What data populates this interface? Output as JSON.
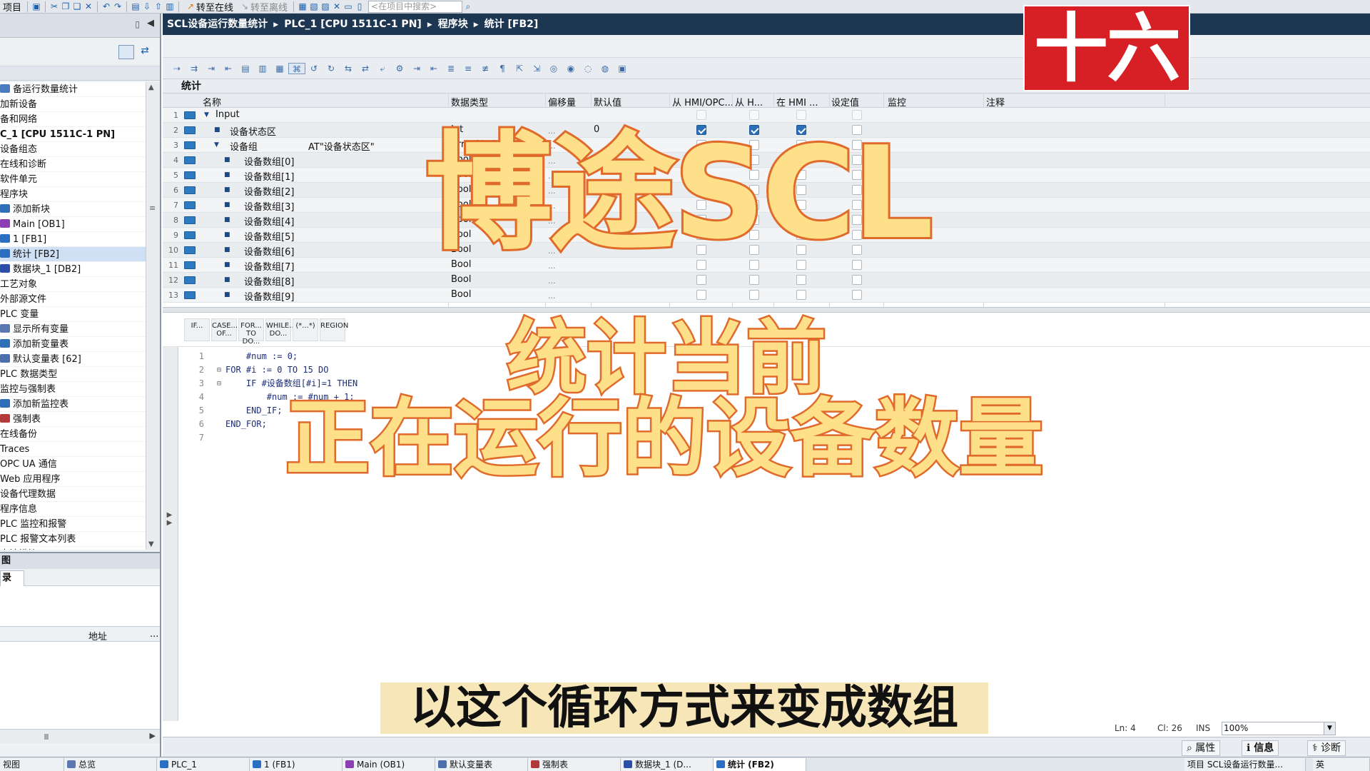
{
  "colors": {
    "accent": "#1d3652",
    "overlay_fill": "#ffe08a",
    "overlay_stroke": "#e06a2a",
    "badge": "#d71f26"
  },
  "toolbar": {
    "project_menu": "项目",
    "go_online": "转至在线",
    "go_offline": "转至离线",
    "search_placeholder": "<在项目中搜索>"
  },
  "breadcrumb": [
    "SCL设备运行数量统计",
    "PLC_1 [CPU 1511C-1 PN]",
    "程序块",
    "统计 [FB2]"
  ],
  "block_name": "统计",
  "tree": [
    {
      "label": "备运行数量统计",
      "icon": "project-icon",
      "sel": false
    },
    {
      "label": "加新设备",
      "icon": "",
      "sel": false
    },
    {
      "label": "备和网络",
      "icon": "",
      "sel": false
    },
    {
      "label": "C_1 [CPU 1511C-1 PN]",
      "icon": "",
      "sel": false,
      "bold": true
    },
    {
      "label": "设备组态",
      "icon": "",
      "sel": false
    },
    {
      "label": "在线和诊断",
      "icon": "",
      "sel": false
    },
    {
      "label": "软件单元",
      "icon": "",
      "sel": false
    },
    {
      "label": "程序块",
      "icon": "",
      "sel": false
    },
    {
      "label": "添加新块",
      "icon": "add-block-icon",
      "sel": false
    },
    {
      "label": "Main [OB1]",
      "icon": "ob-icon",
      "sel": false
    },
    {
      "label": "1 [FB1]",
      "icon": "fb-icon",
      "sel": false
    },
    {
      "label": "统计 [FB2]",
      "icon": "fb-icon",
      "sel": true
    },
    {
      "label": "数据块_1 [DB2]",
      "icon": "db-icon",
      "sel": false
    },
    {
      "label": "工艺对象",
      "icon": "",
      "sel": false
    },
    {
      "label": "外部源文件",
      "icon": "",
      "sel": false
    },
    {
      "label": "PLC 变量",
      "icon": "",
      "sel": false
    },
    {
      "label": "显示所有变量",
      "icon": "tags-icon",
      "sel": false
    },
    {
      "label": "添加新变量表",
      "icon": "add-table-icon",
      "sel": false
    },
    {
      "label": "默认变量表 [62]",
      "icon": "tag-table-icon",
      "sel": false
    },
    {
      "label": "PLC 数据类型",
      "icon": "",
      "sel": false
    },
    {
      "label": "监控与强制表",
      "icon": "",
      "sel": false
    },
    {
      "label": "添加新监控表",
      "icon": "add-table-icon",
      "sel": false
    },
    {
      "label": "强制表",
      "icon": "force-table-icon",
      "sel": false
    },
    {
      "label": "在线备份",
      "icon": "",
      "sel": false
    },
    {
      "label": "Traces",
      "icon": "",
      "sel": false
    },
    {
      "label": "OPC UA 通信",
      "icon": "",
      "sel": false
    },
    {
      "label": "Web 应用程序",
      "icon": "",
      "sel": false
    },
    {
      "label": "设备代理数据",
      "icon": "",
      "sel": false
    },
    {
      "label": "程序信息",
      "icon": "",
      "sel": false
    },
    {
      "label": "PLC 监控和报警",
      "icon": "",
      "sel": false
    },
    {
      "label": "PLC 报警文本列表",
      "icon": "",
      "sel": false
    },
    {
      "label": "本地模块",
      "icon": "",
      "sel": false
    }
  ],
  "left_bottom": {
    "title": "图",
    "tab": "录",
    "col_address": "地址",
    "col_more": "..."
  },
  "grid": {
    "headers": [
      "名称",
      "数据类型",
      "偏移量",
      "默认值",
      "从 HMI/OPC...",
      "从 H...",
      "在 HMI ...",
      "设定值",
      "监控",
      "注释"
    ],
    "rows": [
      {
        "n": "1",
        "indent": 0,
        "expand": "▼",
        "name": "Input",
        "type": "",
        "off": "",
        "def": "",
        "c1": null,
        "c2": null,
        "c3": null,
        "c4": null
      },
      {
        "n": "2",
        "indent": 1,
        "expand": "■",
        "name": "设备状态区",
        "type": "Int",
        "off": "...",
        "def": "0",
        "c1": true,
        "c2": true,
        "c3": true,
        "c4": false
      },
      {
        "n": "3",
        "indent": 1,
        "expand": "▼",
        "name": "设备组",
        "at": "AT\"设备状态区\"",
        "type": "Array[0..15]",
        "off": "...",
        "def": "",
        "c1": false,
        "c2": false,
        "c3": false,
        "c4": false
      },
      {
        "n": "4",
        "indent": 2,
        "expand": "■",
        "name": "设备数组[0]",
        "type": "Bool",
        "off": "...",
        "def": "",
        "c1": false,
        "c2": false,
        "c3": false,
        "c4": false
      },
      {
        "n": "5",
        "indent": 2,
        "expand": "■",
        "name": "设备数组[1]",
        "type": "Bool",
        "off": "...",
        "def": "",
        "c1": false,
        "c2": false,
        "c3": false,
        "c4": false
      },
      {
        "n": "6",
        "indent": 2,
        "expand": "■",
        "name": "设备数组[2]",
        "type": "Bool",
        "off": "...",
        "def": "",
        "c1": false,
        "c2": false,
        "c3": false,
        "c4": false
      },
      {
        "n": "7",
        "indent": 2,
        "expand": "■",
        "name": "设备数组[3]",
        "type": "Bool",
        "off": "...",
        "def": "",
        "c1": false,
        "c2": false,
        "c3": false,
        "c4": false
      },
      {
        "n": "8",
        "indent": 2,
        "expand": "■",
        "name": "设备数组[4]",
        "type": "Bool",
        "off": "...",
        "def": "",
        "c1": false,
        "c2": false,
        "c3": false,
        "c4": false
      },
      {
        "n": "9",
        "indent": 2,
        "expand": "■",
        "name": "设备数组[5]",
        "type": "Bool",
        "off": "...",
        "def": "",
        "c1": false,
        "c2": false,
        "c3": false,
        "c4": false
      },
      {
        "n": "10",
        "indent": 2,
        "expand": "■",
        "name": "设备数组[6]",
        "type": "Bool",
        "off": "...",
        "def": "",
        "c1": false,
        "c2": false,
        "c3": false,
        "c4": false
      },
      {
        "n": "11",
        "indent": 2,
        "expand": "■",
        "name": "设备数组[7]",
        "type": "Bool",
        "off": "...",
        "def": "",
        "c1": false,
        "c2": false,
        "c3": false,
        "c4": false
      },
      {
        "n": "12",
        "indent": 2,
        "expand": "■",
        "name": "设备数组[8]",
        "type": "Bool",
        "off": "...",
        "def": "",
        "c1": false,
        "c2": false,
        "c3": false,
        "c4": false
      },
      {
        "n": "13",
        "indent": 2,
        "expand": "■",
        "name": "设备数组[9]",
        "type": "Bool",
        "off": "...",
        "def": "",
        "c1": false,
        "c2": false,
        "c3": false,
        "c4": false
      }
    ]
  },
  "keywords": [
    "IF...",
    "CASE... OF...",
    "FOR... TO DO...",
    "WHILE... DO...",
    "(*...*)",
    "REGION"
  ],
  "code": [
    {
      "n": "1",
      "fold": "",
      "text": "    #num := 0;"
    },
    {
      "n": "2",
      "fold": "⊟",
      "text": "FOR #i := 0 TO 15 DO"
    },
    {
      "n": "3",
      "fold": "⊟",
      "text": "    IF #设备数组[#i]=1 THEN"
    },
    {
      "n": "4",
      "fold": "",
      "text": "        #num := #num + 1;"
    },
    {
      "n": "5",
      "fold": "",
      "text": "    END_IF;"
    },
    {
      "n": "6",
      "fold": "",
      "text": "END_FOR;"
    },
    {
      "n": "7",
      "fold": "",
      "text": ""
    }
  ],
  "status": {
    "ln": "Ln: 4",
    "cl": "Cl: 26",
    "ins": "INS",
    "zoom": "100%"
  },
  "right_buttons": [
    "属性",
    "信息",
    "诊断"
  ],
  "taskbar": [
    {
      "label": "视图",
      "icon": ""
    },
    {
      "label": "总览",
      "icon": "overview-icon"
    },
    {
      "label": "PLC_1",
      "icon": "plc-icon"
    },
    {
      "label": "1 (FB1)",
      "icon": "fb-icon"
    },
    {
      "label": "Main (OB1)",
      "icon": "ob-icon"
    },
    {
      "label": "默认变量表",
      "icon": "tag-table-icon"
    },
    {
      "label": "强制表",
      "icon": "force-table-icon"
    },
    {
      "label": "数据块_1 (D...",
      "icon": "db-icon"
    },
    {
      "label": "统计 (FB2)",
      "icon": "fb-icon",
      "active": true
    }
  ],
  "taskbar_right": "项目 SCL设备运行数量...",
  "ime": "英",
  "overlay": {
    "badge": "十六",
    "title": "博途SCL",
    "line1": "统计当前",
    "line2": "正在运行的设备数量",
    "subtitle": "以这个循环方式来变成数组"
  }
}
